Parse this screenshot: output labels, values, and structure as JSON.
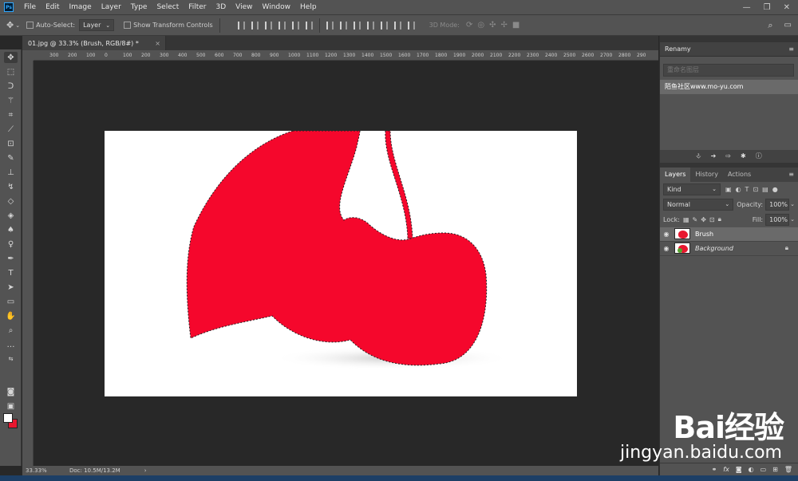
{
  "menubar": {
    "logo": "Ps",
    "items": [
      "File",
      "Edit",
      "Image",
      "Layer",
      "Type",
      "Select",
      "Filter",
      "3D",
      "View",
      "Window",
      "Help"
    ]
  },
  "options": {
    "auto_select_label": "Auto-Select:",
    "auto_select_value": "Layer",
    "transform_controls_label": "Show Transform Controls",
    "mode_3d_label": "3D Mode:"
  },
  "document": {
    "tab_title": "01.jpg @ 33.3% (Brush, RGB/8#) *",
    "zoom": "33.33%",
    "doc_size": "Doc: 10.5M/13.2M"
  },
  "ruler": {
    "ticks": [
      "300",
      "200",
      "100",
      "0",
      "100",
      "200",
      "300",
      "400",
      "500",
      "600",
      "700",
      "800",
      "900",
      "1000",
      "1100",
      "1200",
      "1300",
      "1400",
      "1500",
      "1600",
      "1700",
      "1800",
      "1900",
      "2000",
      "2100",
      "2200",
      "2300",
      "2400",
      "2500",
      "2600",
      "2700",
      "2800",
      "290"
    ]
  },
  "renamy_panel": {
    "title": "Renamy",
    "search_placeholder": "重命名图层",
    "item": "陌鱼社区www.mo-yu.com"
  },
  "layers_panel": {
    "tabs": [
      "Layers",
      "History",
      "Actions"
    ],
    "kind_label": "Kind",
    "blend_mode": "Normal",
    "opacity_label": "Opacity:",
    "opacity_value": "100%",
    "lock_label": "Lock:",
    "fill_label": "Fill:",
    "fill_value": "100%",
    "layers": [
      {
        "name": "Brush",
        "selected": true
      },
      {
        "name": "Background",
        "selected": false,
        "locked": true
      }
    ],
    "footer_fx": "fx"
  },
  "watermark": {
    "brand": "Bai经验",
    "url": "jingyan.baidu.com"
  },
  "colors": {
    "foreground": "#ffffff",
    "background": "#e8172f",
    "shape_fill": "#f5072c"
  }
}
